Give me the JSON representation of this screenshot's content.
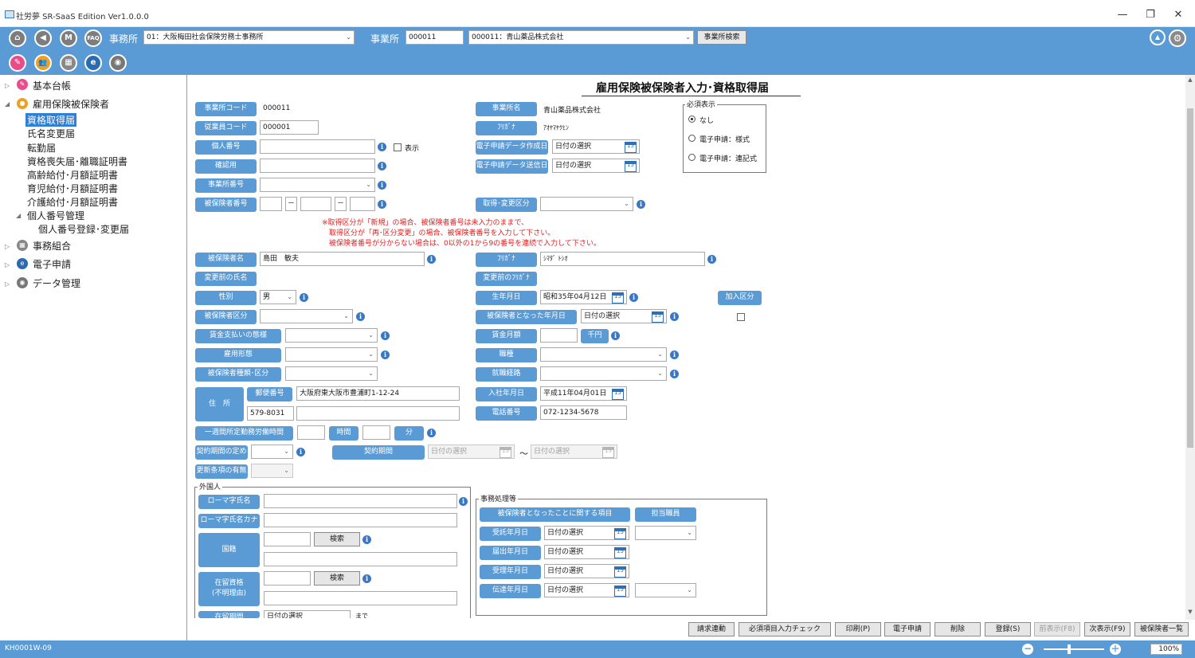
{
  "window": {
    "title": "社労夢 SR-SaaS Edition Ver1.0.0.0",
    "minimize": "—",
    "maximize": "❐",
    "close": "✕"
  },
  "toolbar": {
    "icons_row1": [
      {
        "name": "home-icon",
        "glyph": "⌂"
      },
      {
        "name": "back-icon",
        "glyph": "◀"
      },
      {
        "name": "manual-icon",
        "glyph": "M"
      },
      {
        "name": "faq-icon",
        "glyph": "FAQ"
      }
    ],
    "office_label": "事務所",
    "office_value": "01：大阪梅田社会保険労務士事務所",
    "establishment_label": "事業所",
    "establishment_code": "000011",
    "establishment_value": "000011：青山薬品株式会社",
    "establishment_search": "事業所検索",
    "up_glyph": "▲",
    "icons_row2": [
      {
        "name": "edit-icon",
        "glyph": "✎",
        "color": "#e84c8a"
      },
      {
        "name": "people-icon",
        "glyph": "👥",
        "color": "#f0a020"
      },
      {
        "name": "building-icon",
        "glyph": "▦",
        "color": "#888888"
      },
      {
        "name": "e-application-icon",
        "glyph": "e",
        "color": "#2b6cb0"
      },
      {
        "name": "camera-icon",
        "glyph": "◉",
        "color": "#777777"
      }
    ]
  },
  "tree": {
    "items": [
      {
        "label": "基本台帳",
        "level": 0,
        "icon": "basic-ledger-icon",
        "color": "#e84c8a",
        "expander": "▷"
      },
      {
        "label": "雇用保険被保険者",
        "level": 0,
        "icon": "insured-icon",
        "color": "#f0a020",
        "expander": "◢"
      },
      {
        "label": "資格取得届",
        "level": 1,
        "selected": true
      },
      {
        "label": "氏名変更届",
        "level": 1
      },
      {
        "label": "転勤届",
        "level": 1
      },
      {
        "label": "資格喪失届･離職証明書",
        "level": 1
      },
      {
        "label": "高齢給付･月額証明書",
        "level": 1
      },
      {
        "label": "育児給付･月額証明書",
        "level": 1
      },
      {
        "label": "介護給付･月額証明書",
        "level": 1
      },
      {
        "label": "個人番号管理",
        "level": 1,
        "expander": "◢"
      },
      {
        "label": "個人番号登録･変更届",
        "level": 2
      },
      {
        "label": "事務組合",
        "level": 0,
        "icon": "union-icon",
        "color": "#888888",
        "expander": "▷"
      },
      {
        "label": "電子申請",
        "level": 0,
        "icon": "e-filing-icon",
        "color": "#2b6cb0",
        "expander": "▷"
      },
      {
        "label": "データ管理",
        "level": 0,
        "icon": "data-management-icon",
        "color": "#777777",
        "expander": "▷"
      }
    ]
  },
  "form": {
    "title": "雇用保険被保険者入力･資格取得届",
    "labels": {
      "office_code": "事業所コード",
      "employee_code": "従業員コード",
      "personal_number": "個人番号",
      "confirm": "確認用",
      "office_number": "事業所番号",
      "insured_number": "被保険者番号",
      "office_name": "事業所名",
      "furigana": "ﾌﾘｶﾞﾅ",
      "e_created": "電子申請データ作成日",
      "e_sent": "電子申請データ送信日",
      "acquire_type": "取得･変更区分",
      "insured_name": "被保険者名",
      "furigana2": "ﾌﾘｶﾞﾅ",
      "prev_name": "変更前の氏名",
      "prev_furigana": "変更前のﾌﾘｶﾞﾅ",
      "gender": "性別",
      "birthdate": "生年月日",
      "join_type": "加入区分",
      "insured_class": "被保険者区分",
      "became_insured_date": "被保険者となった年月日",
      "wage_type": "賃金支払いの態様",
      "wage_monthly": "賃金月額",
      "wage_unit": "千円",
      "employment_type": "雇用形態",
      "occupation": "職種",
      "insured_kind": "被保険者種類･区分",
      "job_route": "就職経路",
      "address": "住　所",
      "postal": "郵便番号",
      "join_date": "入社年月日",
      "phone": "電話番号",
      "weekly_hours": "一週間所定勤務労働時間",
      "hours": "時間",
      "minutes": "分",
      "contract_defined": "契約期間の定め",
      "contract_period": "契約期間",
      "renewal": "更新条項の有無"
    },
    "values": {
      "office_code": "000011",
      "employee_code": "000001",
      "show_label": "表示",
      "office_name": "青山薬品株式会社",
      "office_furigana": "ｱｵﾔﾏﾔｸﾋﾝ",
      "date_placeholder": "日付の選択",
      "insured_name": "島田　敏夫",
      "insured_furigana": "ｼﾏﾀﾞ ﾄｼｵ",
      "gender": "男",
      "birthdate": "昭和35年04月12日",
      "address": "大阪府東大阪市豊浦町1-12-24",
      "postal": "579-8031",
      "join_date": "平成11年04月01日",
      "phone": "072-1234-5678",
      "tilde": "～",
      "dash": "－"
    },
    "notes": [
      "※取得区分が「新規」の場合、被保険者番号は未入力のままで、",
      "取得区分が「再･区分変更」の場合、被保険者番号を入力して下さい。",
      "被保険者番号が分からない場合は、0以外の1から9の番号を連続で入力して下さい。"
    ],
    "required_display": {
      "title": "必須表示",
      "options": [
        "なし",
        "電子申請：様式",
        "電子申請：連記式"
      ],
      "selected": 0
    },
    "foreigner": {
      "title": "外国人",
      "roman_name": "ローマ字氏名",
      "roman_kana": "ローマ字氏名カナ",
      "nationality": "国籍",
      "search": "検索",
      "residence_status": "在留資格\n(不明理由)",
      "search2": "検索",
      "residence_period": "在留期間",
      "until": "まで"
    },
    "office_processing": {
      "title": "事務処理等",
      "header1": "被保険者となったことに関する項目",
      "header2": "担当職員",
      "rows": [
        "受託年月日",
        "届出年月日",
        "受理年月日",
        "伝達年月日"
      ]
    }
  },
  "bottom_buttons": [
    {
      "label": "請求連動",
      "enabled": true
    },
    {
      "label": "必須項目入力チェック",
      "enabled": true
    },
    {
      "label": "印刷(P)",
      "enabled": true
    },
    {
      "label": "電子申請",
      "enabled": true
    },
    {
      "label": "削除",
      "enabled": true
    },
    {
      "label": "登録(S)",
      "enabled": true
    },
    {
      "label": "前表示(F8)",
      "enabled": false
    },
    {
      "label": "次表示(F9)",
      "enabled": true
    },
    {
      "label": "被保険者一覧",
      "enabled": true
    }
  ],
  "status": {
    "screen_id": "KH0001W-09",
    "zoom": "100%",
    "zoom_minus": "−",
    "zoom_plus": "＋"
  }
}
